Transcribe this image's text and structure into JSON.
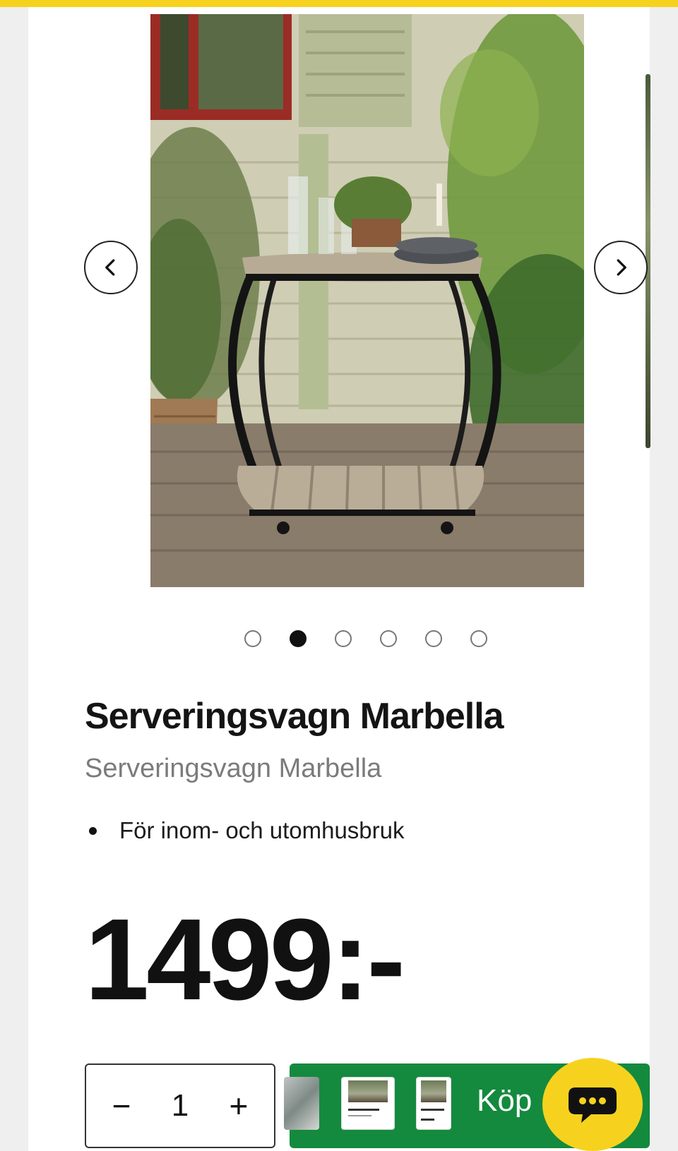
{
  "colors": {
    "top_bar": "#f6d21f",
    "buy_button": "#148a3e",
    "chat_button": "#f6d21f",
    "text_primary": "#141414",
    "text_secondary": "#7b7b7b"
  },
  "gallery": {
    "image_alt": "Serveringsvagn Marbella",
    "prev_icon": "chevron-left-icon",
    "next_icon": "chevron-right-icon",
    "dot_count": 6,
    "active_index": 1
  },
  "product": {
    "title": "Serveringsvagn Marbella",
    "subtitle": "Serveringsvagn Marbella",
    "features": [
      "För inom- och utomhusbruk"
    ],
    "price": "1499:-"
  },
  "purchase": {
    "decrement": "−",
    "quantity": "1",
    "increment": "+",
    "buy_label": "Köp"
  },
  "chat": {
    "icon": "chat-bubble-icon"
  }
}
